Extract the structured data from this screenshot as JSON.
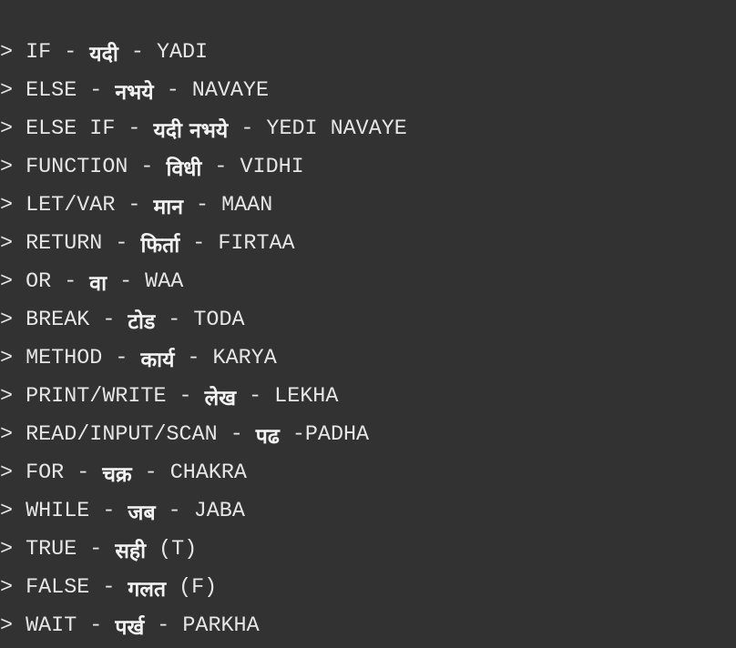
{
  "prompt_symbol": ">",
  "lines": [
    {
      "english": "IF",
      "sep1": " - ",
      "nepali": "यदी",
      "sep2": " - ",
      "roman": "YADI"
    },
    {
      "english": "ELSE",
      "sep1": " - ",
      "nepali": "नभये",
      "sep2": " - ",
      "roman": "NAVAYE"
    },
    {
      "english": "ELSE IF",
      "sep1": " - ",
      "nepali": "यदी नभये",
      "sep2": " - ",
      "roman": "YEDI NAVAYE"
    },
    {
      "english": "FUNCTION",
      "sep1": " - ",
      "nepali": "विधी",
      "sep2": " - ",
      "roman": "VIDHI"
    },
    {
      "english": "LET/VAR",
      "sep1": " - ",
      "nepali": "मान",
      "sep2": " - ",
      "roman": "MAAN"
    },
    {
      "english": "RETURN",
      "sep1": " - ",
      "nepali": "फिर्ता",
      "sep2": " - ",
      "roman": "FIRTAA"
    },
    {
      "english": "OR",
      "sep1": " - ",
      "nepali": "वा",
      "sep2": " - ",
      "roman": "WAA"
    },
    {
      "english": "BREAK",
      "sep1": " - ",
      "nepali": "टोड",
      "sep2": " - ",
      "roman": "TODA"
    },
    {
      "english": "METHOD",
      "sep1": " - ",
      "nepali": "कार्य",
      "sep2": " - ",
      "roman": "KARYA"
    },
    {
      "english": "PRINT/WRITE",
      "sep1": " - ",
      "nepali": "लेख",
      "sep2": " - ",
      "roman": "LEKHA"
    },
    {
      "english": "READ/INPUT/SCAN",
      "sep1": " - ",
      "nepali": "पढ",
      "sep2": " -",
      "roman": "PADHA"
    },
    {
      "english": "FOR",
      "sep1": " - ",
      "nepali": "चक्र",
      "sep2": " - ",
      "roman": "CHAKRA"
    },
    {
      "english": "WHILE",
      "sep1": " - ",
      "nepali": "जब",
      "sep2": " - ",
      "roman": "JABA"
    },
    {
      "english": "TRUE",
      "sep1": " - ",
      "nepali": "सही",
      "sep2": " ",
      "roman": "(T)"
    },
    {
      "english": "FALSE",
      "sep1": " - ",
      "nepali": "गलत",
      "sep2": " ",
      "roman": "(F)"
    },
    {
      "english": "WAIT",
      "sep1": " - ",
      "nepali": "पर्ख",
      "sep2": " - ",
      "roman": "PARKHA"
    }
  ]
}
